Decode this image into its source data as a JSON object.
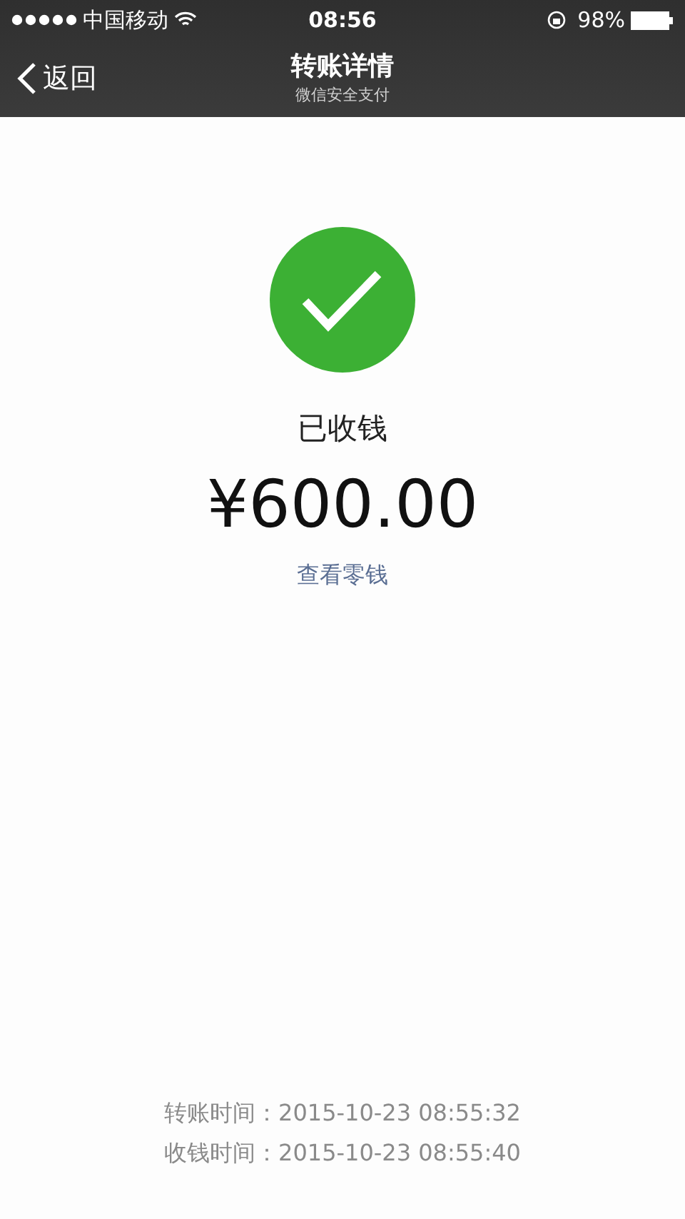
{
  "status_bar": {
    "carrier": "中国移动",
    "time": "08:56",
    "battery": "98%"
  },
  "nav": {
    "back": "返回",
    "title": "转账详情",
    "subtitle": "微信安全支付"
  },
  "result": {
    "status": "已收钱",
    "amount": "¥600.00",
    "link": "查看零钱"
  },
  "times": [
    {
      "label": "转账时间：",
      "value": "2015-10-23 08:55:32"
    },
    {
      "label": "收钱时间：",
      "value": "2015-10-23 08:55:40"
    }
  ]
}
